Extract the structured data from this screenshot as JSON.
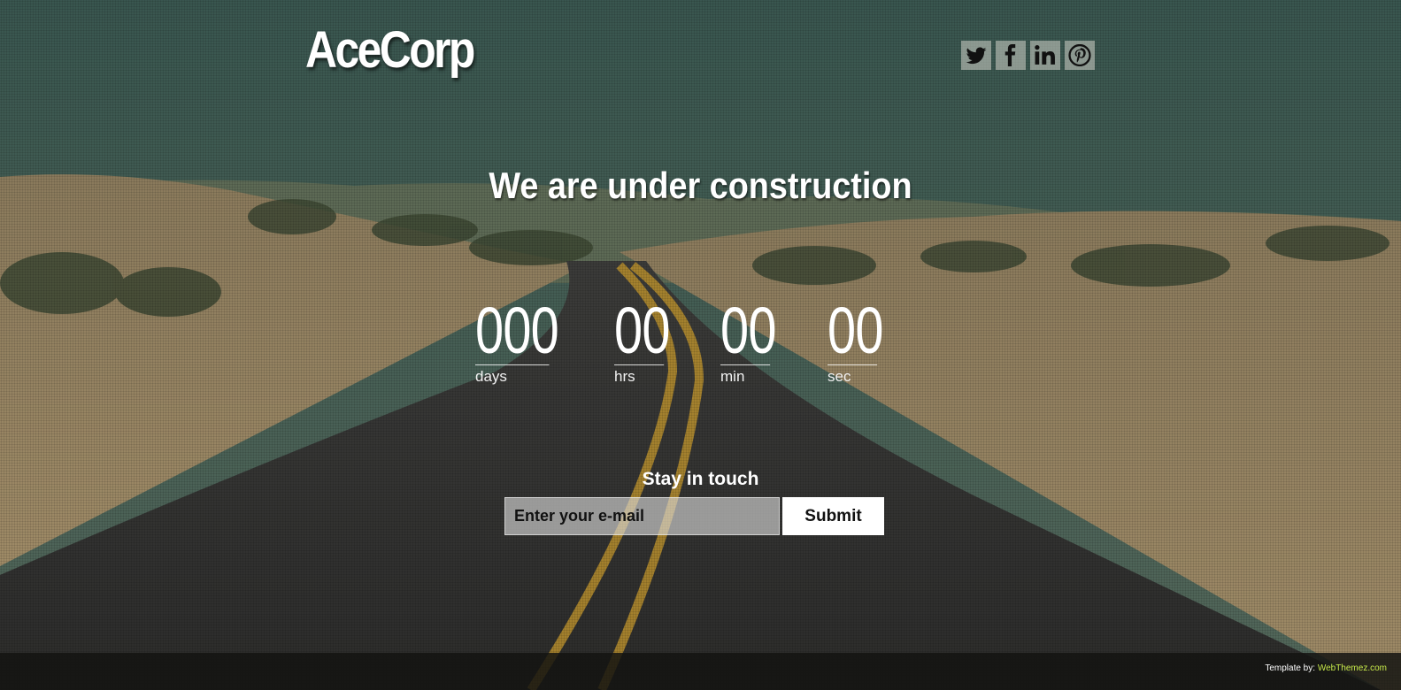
{
  "brand": {
    "logo": "AceCorp"
  },
  "social": {
    "items": [
      {
        "name": "twitter-icon",
        "label": "Twitter"
      },
      {
        "name": "facebook-icon",
        "label": "Facebook"
      },
      {
        "name": "linkedin-icon",
        "label": "LinkedIn"
      },
      {
        "name": "pinterest-icon",
        "label": "Pinterest"
      }
    ],
    "tile_color": "#cfcfc6"
  },
  "hero": {
    "headline": "We are under construction"
  },
  "countdown": {
    "days": {
      "value": "000",
      "label": "days"
    },
    "hours": {
      "value": "00",
      "label": "hrs"
    },
    "minutes": {
      "value": "00",
      "label": "min"
    },
    "seconds": {
      "value": "00",
      "label": "sec"
    }
  },
  "subscribe": {
    "heading": "Stay in touch",
    "email_placeholder": "Enter your e-mail",
    "email_value": "",
    "submit_label": "Submit"
  },
  "footer": {
    "credit_prefix": "Template by:",
    "credit_link": "WebThemez.com",
    "credit_link_color": "#c6e84a"
  }
}
